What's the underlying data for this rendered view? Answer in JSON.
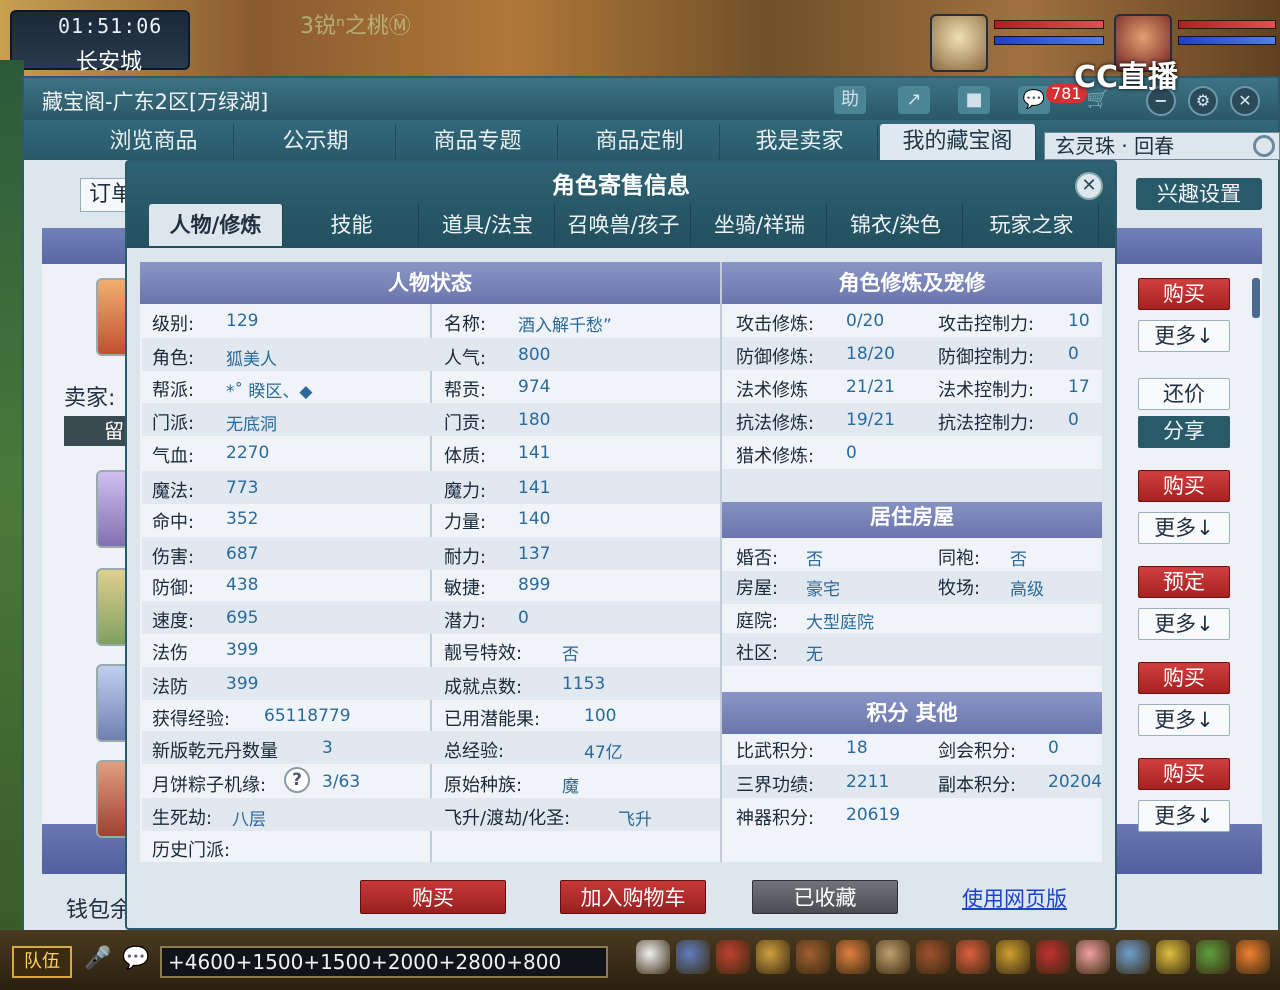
{
  "scene": {
    "clock": "01:51:06",
    "city": "长安城",
    "scene_title": "3锐ⁿ之桃Ⓜ",
    "stream_logo": "CC直播"
  },
  "window": {
    "title": "藏宝阁-广东2区[万绿湖]",
    "help_label": "助",
    "badge": "781",
    "nav": [
      "浏览商品",
      "公示期",
      "商品专题",
      "商品定制",
      "我是卖家",
      "我的藏宝阁"
    ],
    "search_value": "玄灵珠 · 回春",
    "order_label": "订单",
    "interest_label": "兴趣设置",
    "seller_label": "卖家:",
    "leave_label": "留",
    "wallet_label": "钱包余",
    "side_buttons": [
      "购买",
      "更多↓",
      "还价",
      "分享",
      "购买",
      "更多↓",
      "预定",
      "更多↓",
      "购买",
      "更多↓",
      "购买",
      "更多↓"
    ]
  },
  "modal": {
    "title": "角色寄售信息",
    "tabs": [
      "人物/修炼",
      "技能",
      "道具/法宝",
      "召唤兽/孩子",
      "坐骑/祥瑞",
      "锦衣/染色",
      "玩家之家"
    ],
    "status_title": "人物状态",
    "cultivation_title": "角色修炼及宠修",
    "house_title": "居住房屋",
    "score_title": "积分 其他",
    "status_left": [
      {
        "label": "级别:",
        "value": "129"
      },
      {
        "label": "角色:",
        "value": "狐美人"
      },
      {
        "label": "帮派:",
        "value": "*˚ 睽区、◆"
      },
      {
        "label": "门派:",
        "value": "无底洞"
      },
      {
        "label": "气血:",
        "value": "2270"
      },
      {
        "label": "魔法:",
        "value": "773"
      },
      {
        "label": "命中:",
        "value": "352"
      },
      {
        "label": "伤害:",
        "value": "687"
      },
      {
        "label": "防御:",
        "value": "438"
      },
      {
        "label": "速度:",
        "value": "695"
      },
      {
        "label": "法伤",
        "value": "399"
      },
      {
        "label": "法防",
        "value": "399"
      },
      {
        "label": "获得经验:",
        "value": "65118779"
      },
      {
        "label": "新版乾元丹数量",
        "value": "3"
      },
      {
        "label": "月饼粽子机缘:",
        "value": "3/63"
      },
      {
        "label": "生死劫:",
        "value": "八层"
      },
      {
        "label": "历史门派:",
        "value": ""
      }
    ],
    "status_right": [
      {
        "label": "名称:",
        "value": "酒入解千愁ˮ"
      },
      {
        "label": "人气:",
        "value": "800"
      },
      {
        "label": "帮贡:",
        "value": "974"
      },
      {
        "label": "门贡:",
        "value": "180"
      },
      {
        "label": "体质:",
        "value": "141"
      },
      {
        "label": "魔力:",
        "value": "141"
      },
      {
        "label": "力量:",
        "value": "140"
      },
      {
        "label": "耐力:",
        "value": "137"
      },
      {
        "label": "敏捷:",
        "value": "899"
      },
      {
        "label": "潜力:",
        "value": "0"
      },
      {
        "label": "靓号特效:",
        "value": "否"
      },
      {
        "label": "成就点数:",
        "value": "1153"
      },
      {
        "label": "已用潜能果:",
        "value": "100"
      },
      {
        "label": "总经验:",
        "value": "47亿"
      },
      {
        "label": "原始种族:",
        "value": "魔"
      },
      {
        "label": "飞升/渡劫/化圣:",
        "value": "飞升"
      }
    ],
    "cultivation": [
      {
        "label": "攻击修炼:",
        "value": "0/20",
        "label2": "攻击控制力:",
        "value2": "10"
      },
      {
        "label": "防御修炼:",
        "value": "18/20",
        "label2": "防御控制力:",
        "value2": "0"
      },
      {
        "label": "法术修炼",
        "value": "21/21",
        "label2": "法术控制力:",
        "value2": "17"
      },
      {
        "label": "抗法修炼:",
        "value": "19/21",
        "label2": "抗法控制力:",
        "value2": "0"
      },
      {
        "label": "猎术修炼:",
        "value": "0",
        "label2": "",
        "value2": ""
      }
    ],
    "house": [
      {
        "label": "婚否:",
        "value": "否",
        "label2": "同袍:",
        "value2": "否"
      },
      {
        "label": "房屋:",
        "value": "豪宅",
        "label2": "牧场:",
        "value2": "高级"
      },
      {
        "label": "庭院:",
        "value": "大型庭院",
        "label2": "",
        "value2": ""
      },
      {
        "label": "社区:",
        "value": "无",
        "label2": "",
        "value2": ""
      }
    ],
    "scores": [
      {
        "label": "比武积分:",
        "value": "18",
        "label2": "剑会积分:",
        "value2": "0"
      },
      {
        "label": "三界功绩:",
        "value": "2211",
        "label2": "副本积分:",
        "value2": "20204"
      },
      {
        "label": "神器积分:",
        "value": "20619",
        "label2": "",
        "value2": ""
      }
    ],
    "buy_label": "购买",
    "cart_label": "加入购物车",
    "collected_label": "已收藏",
    "web_label": "使用网页版"
  },
  "bottom": {
    "team_label": "队伍",
    "chat_text": "+4600+1500+1500+2000+2800+800"
  },
  "colors": {
    "header_teal": "#2a5866",
    "section_purple": "#7a86bc",
    "value_blue": "#2a6a9a",
    "buy_red": "#c83838"
  }
}
